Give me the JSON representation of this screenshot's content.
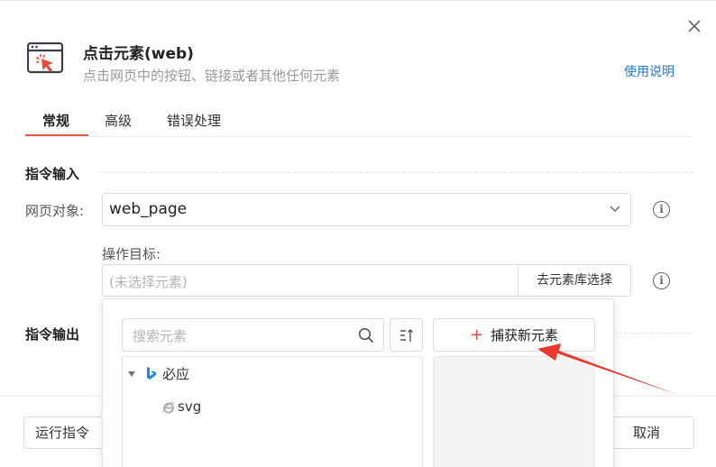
{
  "dialog": {
    "title": "点击元素(web)",
    "subtitle": "点击网页中的按钮、链接或者其他任何元素",
    "help_link": "使用说明",
    "close_icon": "close-icon",
    "header_icon": "cursor-click-icon"
  },
  "tabs": [
    {
      "label": "常规",
      "active": true
    },
    {
      "label": "高级",
      "active": false
    },
    {
      "label": "错误处理",
      "active": false
    }
  ],
  "sections": {
    "input_title": "指令输入",
    "output_title": "指令输出"
  },
  "fields": {
    "web_object_label": "网页对象:",
    "web_object_value": "web_page",
    "target_label": "操作目标:",
    "target_placeholder": "(未选择元素)",
    "library_button": "去元素库选择"
  },
  "popup": {
    "search_placeholder": "搜索元素",
    "capture_button": "捕获新元素",
    "tree": [
      {
        "label": "必应",
        "level": 0,
        "icon": "bing-icon",
        "expanded": true
      },
      {
        "label": "svg",
        "level": 1,
        "icon": "ie-icon"
      }
    ]
  },
  "footer": {
    "run_button": "运行指令",
    "cancel_button": "取消"
  },
  "colors": {
    "accent": "#e85a47",
    "link": "#1e7ad6",
    "annotation_arrow": "#e8392c"
  }
}
